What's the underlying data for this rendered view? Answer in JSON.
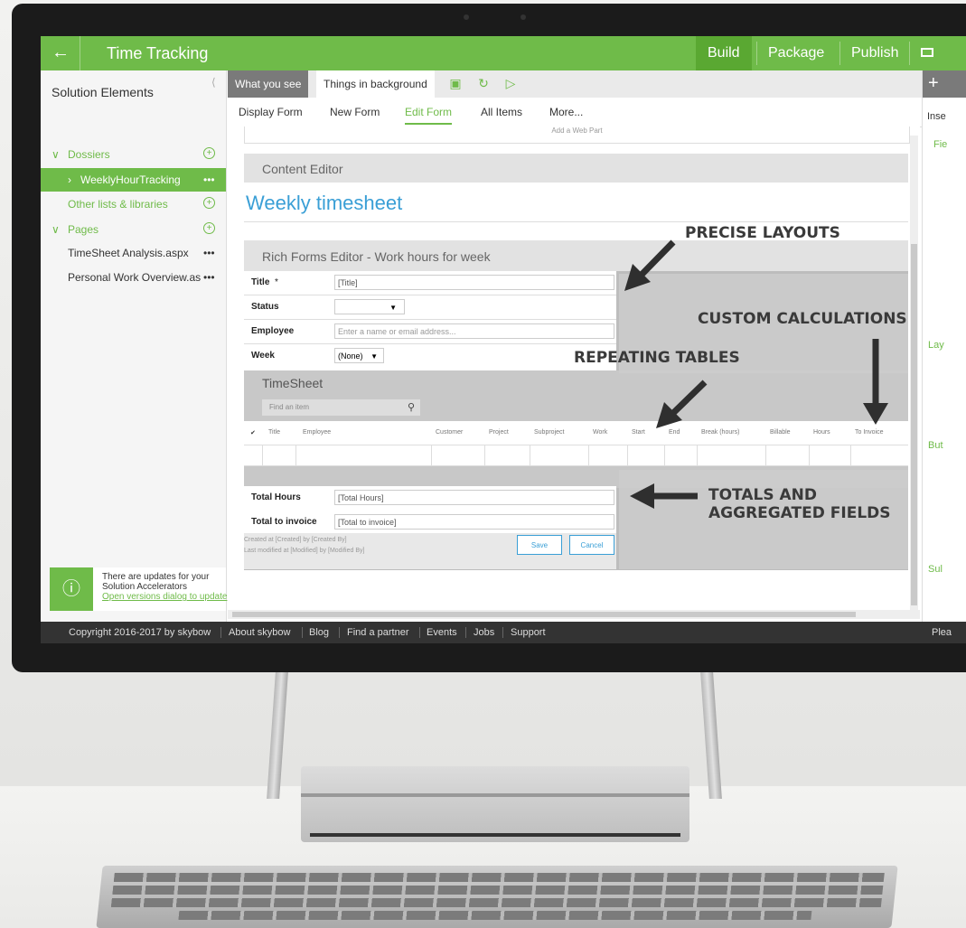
{
  "app": {
    "title": "Time Tracking",
    "nav_tabs": [
      {
        "label": "Build",
        "active": true
      },
      {
        "label": "Package",
        "active": false
      },
      {
        "label": "Publish",
        "active": false
      }
    ]
  },
  "sidebar": {
    "title": "Solution Elements",
    "items": [
      {
        "label": "Dossiers",
        "type": "group"
      },
      {
        "label": "WeeklyHourTracking",
        "type": "selected"
      },
      {
        "label": "Other lists & libraries",
        "type": "group"
      },
      {
        "label": "Pages",
        "type": "group"
      },
      {
        "label": "TimeSheet Analysis.aspx",
        "type": "item"
      },
      {
        "label": "Personal Work Overview.as",
        "type": "item"
      }
    ],
    "more": "•••",
    "update": {
      "line1": "There are updates for your",
      "line2": "Solution Accelerators",
      "link": "Open versions dialog to update"
    }
  },
  "toolbar": {
    "view_tabs": [
      "What you see",
      "Things in background"
    ]
  },
  "form_tabs": [
    {
      "label": "Display Form",
      "active": false
    },
    {
      "label": "New Form",
      "active": false
    },
    {
      "label": "Edit Form",
      "active": true
    },
    {
      "label": "All Items",
      "active": false
    },
    {
      "label": "More...",
      "active": false
    }
  ],
  "right_panel": {
    "header": "Inse",
    "labels": [
      "Fie",
      "Lay",
      "But",
      "Sul"
    ],
    "footer_text": "Plea"
  },
  "canvas": {
    "add_webpart": "Add a Web Part",
    "content_editor_title": "Content Editor",
    "weekly_heading": "Weekly timesheet",
    "rich_forms_title": "Rich Forms Editor - Work hours for week",
    "fields": [
      {
        "label": "Title",
        "required": "*",
        "value": "[Title]"
      },
      {
        "label": "Status",
        "value": ""
      },
      {
        "label": "Employee",
        "placeholder": "Enter a name or email address..."
      },
      {
        "label": "Week",
        "value": "(None)"
      }
    ],
    "timesheet": {
      "title": "TimeSheet",
      "find_placeholder": "Find an item",
      "columns": [
        "Title",
        "Employee",
        "Customer",
        "Project",
        "Subproject",
        "Work",
        "Start",
        "End",
        "Break (hours)",
        "Billable",
        "Hours",
        "To Invoice"
      ]
    },
    "totals": [
      {
        "label": "Total Hours",
        "value": "[Total Hours]"
      },
      {
        "label": "Total to invoice",
        "value": "[Total to invoice]"
      }
    ],
    "meta": {
      "created": "Created at [Created]    by    [Created By]",
      "modified": "Last modified at [Modified]    by    [Modified By]"
    },
    "buttons": {
      "save": "Save",
      "cancel": "Cancel"
    }
  },
  "footer": {
    "copyright": "Copyright 2016-2017 by skybow",
    "links": [
      "About skybow",
      "Blog",
      "Find a partner",
      "Events",
      "Jobs",
      "Support"
    ]
  },
  "callouts": {
    "precise": "PRECISE LAYOUTS",
    "calculations": "CUSTOM CALCULATIONS",
    "repeating": "REPEATING TABLES",
    "totals_line1": "TOTALS AND",
    "totals_line2": "AGGREGATED FIELDS"
  },
  "colors": {
    "brand_green": "#6fbb49",
    "link_blue": "#3a9fd6",
    "footer_dark": "#333333"
  }
}
